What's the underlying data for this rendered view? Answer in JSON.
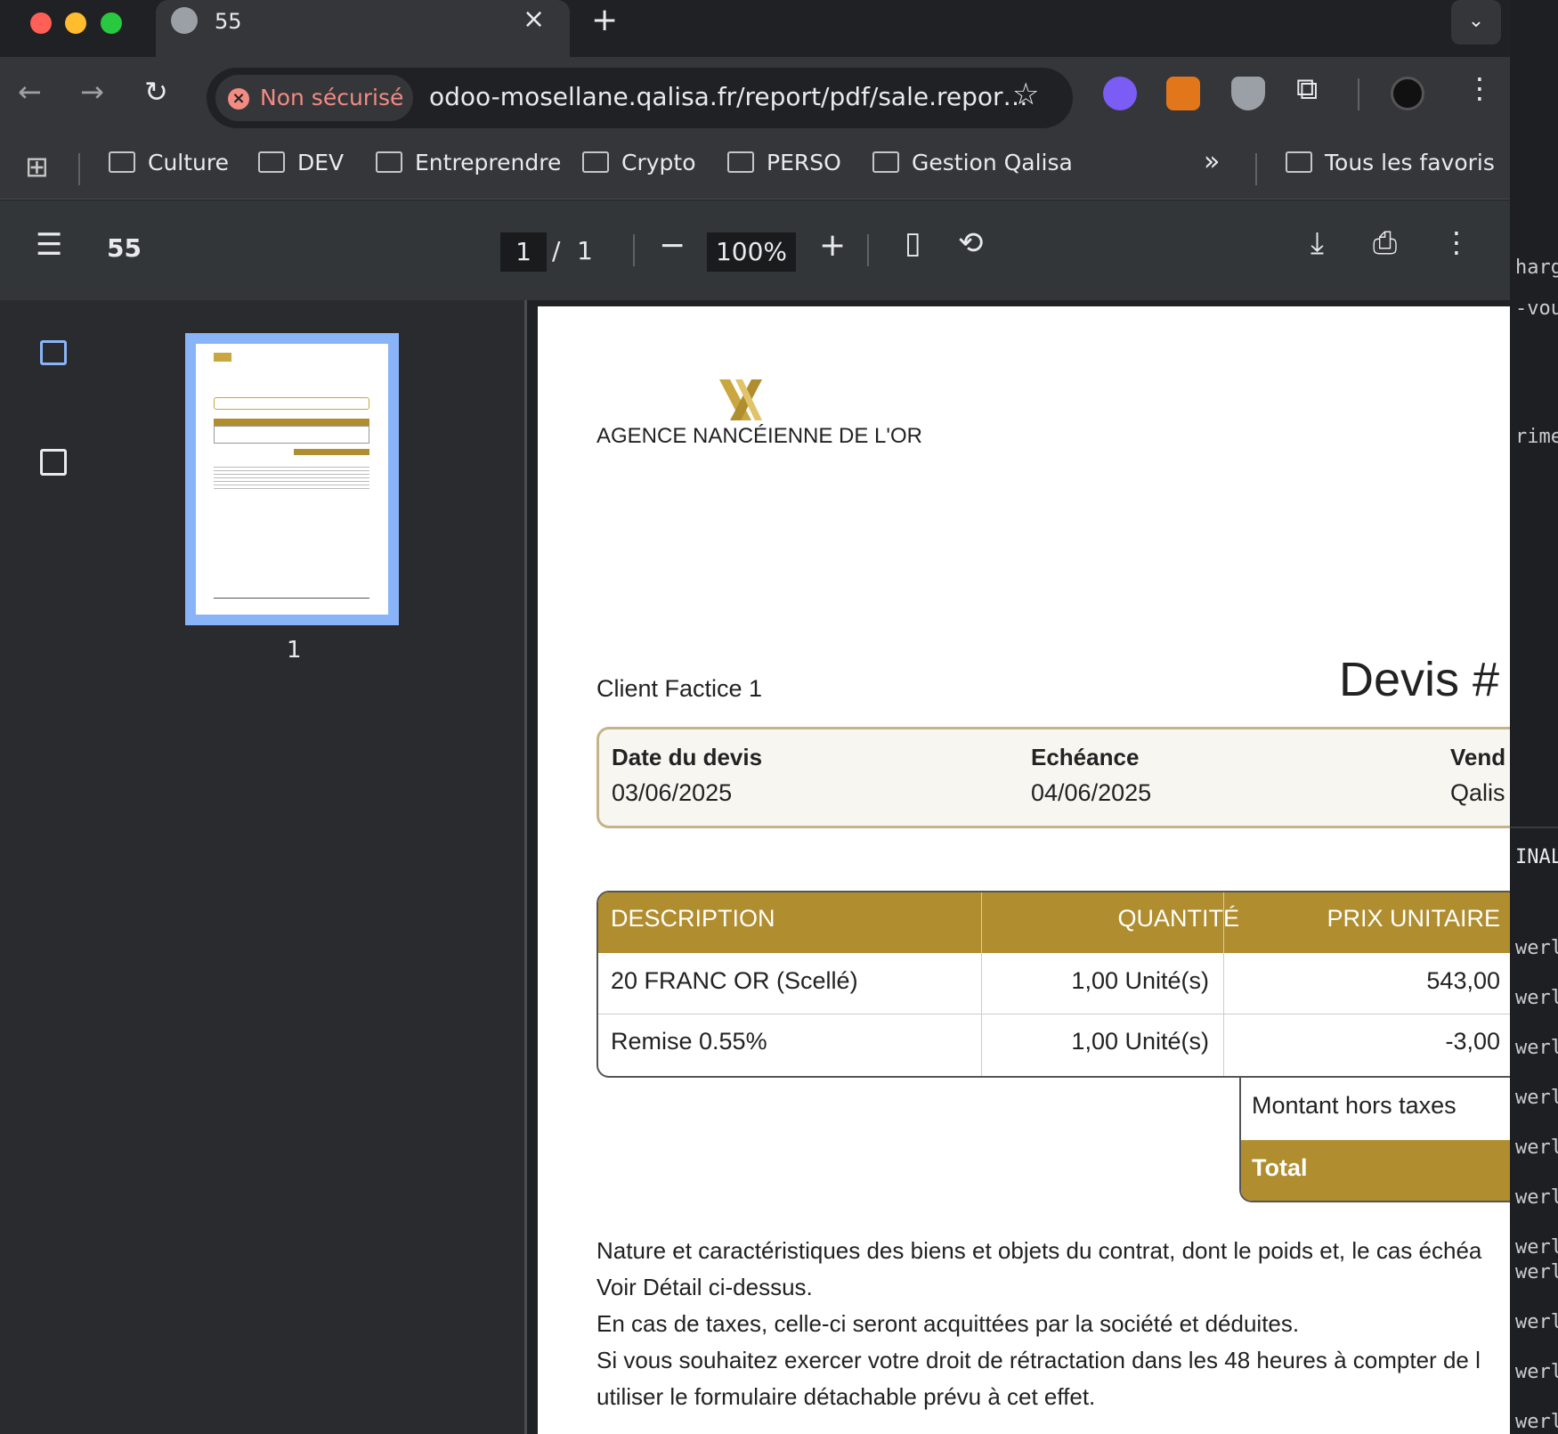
{
  "browser": {
    "tab_title": "55",
    "security_label": "Non sécurisé",
    "url": "odoo-mosellane.qalisa.fr/report/pdf/sale.repor…",
    "bookmarks": [
      "Culture",
      "DEV",
      "Entreprendre",
      "Crypto",
      "PERSO",
      "Gestion Qalisa"
    ],
    "more_bookmarks": "»",
    "all_favorites": "Tous les favoris"
  },
  "pdf_viewer": {
    "doc_title": "55",
    "current_page": "1",
    "page_sep": "/",
    "total_pages": "1",
    "zoom": "100%",
    "thumbnail_label": "1"
  },
  "document": {
    "company_name": "AGENCE NANCÉIENNE DE L'OR",
    "client": "Client Factice 1",
    "title": "Devis #",
    "info": {
      "date_label": "Date du devis",
      "date_value": "03/06/2025",
      "due_label": "Echéance",
      "due_value": "04/06/2025",
      "seller_label": "Vend",
      "seller_value": "Qalis"
    },
    "table": {
      "headers": [
        "DESCRIPTION",
        "QUANTITÉ",
        "PRIX UNITAIRE"
      ],
      "rows": [
        [
          "20 FRANC OR (Scellé)",
          "1,00 Unité(s)",
          "543,00"
        ],
        [
          "Remise 0.55%",
          "1,00 Unité(s)",
          "-3,00"
        ]
      ]
    },
    "totals": {
      "subtotal_label": "Montant hors taxes",
      "total_label": "Total"
    },
    "notes": [
      "Nature et caractéristiques des biens et objets du contrat, dont le poids et, le cas échéa",
      "Voir Détail ci-dessus.",
      "En cas de taxes, celle-ci seront acquittées par la société et déduites.",
      "Si vous souhaitez exercer votre droit de rétractation dans les 48 heures à compter de l",
      "utiliser le formulaire détachable prévu à cet effet."
    ]
  },
  "side_terminal": {
    "lines": [
      "harg",
      "-vous",
      "rime",
      "INAL",
      "werl",
      "werl",
      "werl",
      "werl",
      "werl",
      "werl",
      "werl",
      "werl",
      "werl",
      "werl",
      "werl"
    ]
  },
  "colors": {
    "gold": "#b08d2e",
    "accent_blue": "#8ab4f8"
  }
}
